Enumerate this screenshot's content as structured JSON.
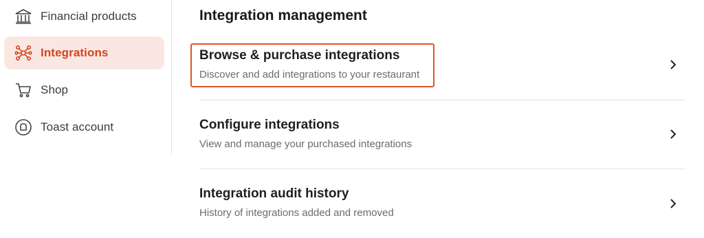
{
  "sidebar": {
    "items": [
      {
        "label": "Financial products",
        "icon": "bank-icon"
      },
      {
        "label": "Integrations",
        "icon": "network-icon",
        "active": true
      },
      {
        "label": "Shop",
        "icon": "cart-icon"
      },
      {
        "label": "Toast account",
        "icon": "toast-account-icon"
      }
    ]
  },
  "main": {
    "title": "Integration management",
    "rows": [
      {
        "title": "Browse & purchase integrations",
        "description": "Discover and add integrations to your restaurant"
      },
      {
        "title": "Configure integrations",
        "description": "View and manage your purchased integrations"
      },
      {
        "title": "Integration audit history",
        "description": "History of integrations added and removed"
      }
    ]
  },
  "colors": {
    "accent": "#d2451e",
    "active_bg": "#fbe7e1",
    "highlight_border": "#e0532b"
  }
}
